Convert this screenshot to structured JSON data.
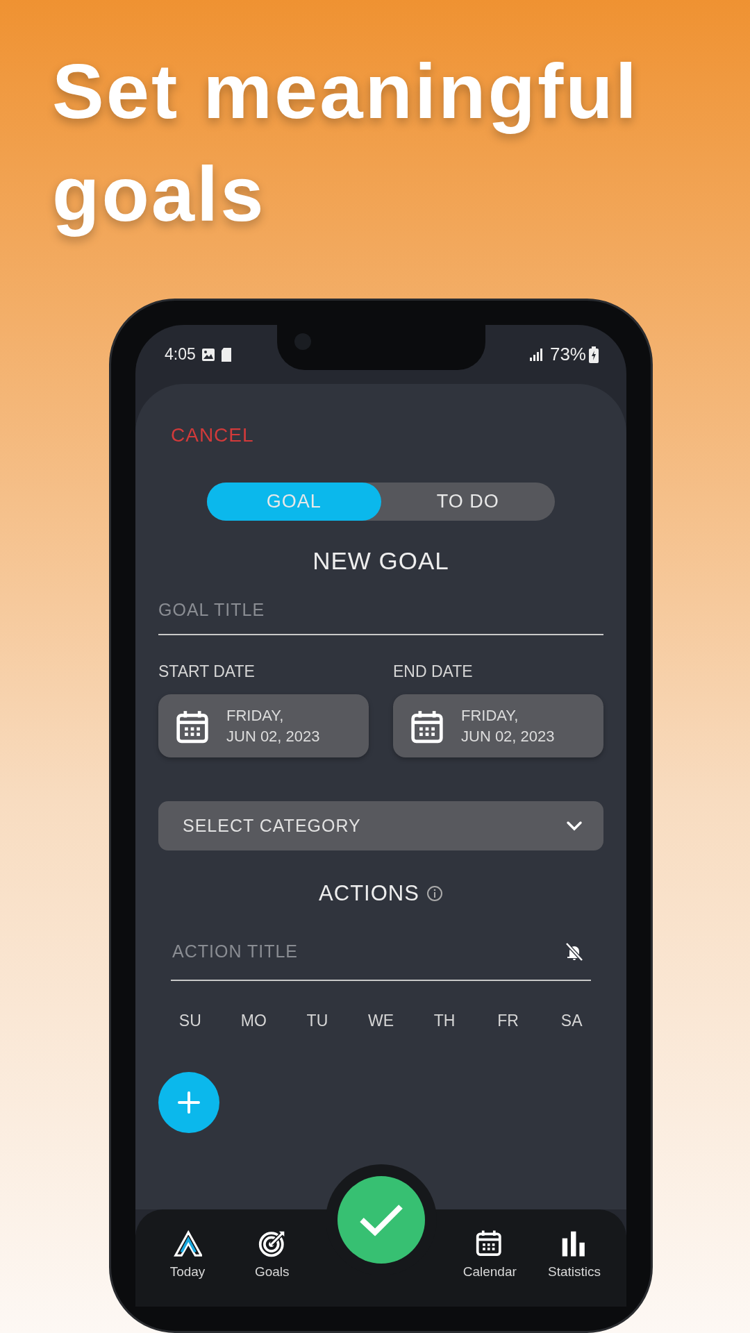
{
  "headline": "Set meaningful goals",
  "status_bar": {
    "time": "4:05",
    "battery": "73%"
  },
  "cancel": "CANCEL",
  "tabs": [
    {
      "label": "GOAL",
      "selected": true
    },
    {
      "label": "TO DO",
      "selected": false
    }
  ],
  "form_title": "NEW GOAL",
  "goal_title": {
    "placeholder": "GOAL TITLE"
  },
  "dates": [
    {
      "label": "START DATE",
      "weekday": "FRIDAY,",
      "date": "JUN 02, 2023"
    },
    {
      "label": "END DATE",
      "weekday": "FRIDAY,",
      "date": "JUN 02, 2023"
    }
  ],
  "category": {
    "placeholder": "SELECT CATEGORY"
  },
  "actions": {
    "title": "ACTIONS",
    "action_title": {
      "placeholder": "ACTION TITLE"
    },
    "days": [
      "SU",
      "MO",
      "TU",
      "WE",
      "TH",
      "FR",
      "SA"
    ]
  },
  "bottom_nav": [
    {
      "label": "Today",
      "kind": "today"
    },
    {
      "label": "Goals",
      "kind": "goals"
    },
    {
      "label": "Calendar",
      "kind": "calendar"
    },
    {
      "label": "Statistics",
      "kind": "statistics"
    }
  ]
}
